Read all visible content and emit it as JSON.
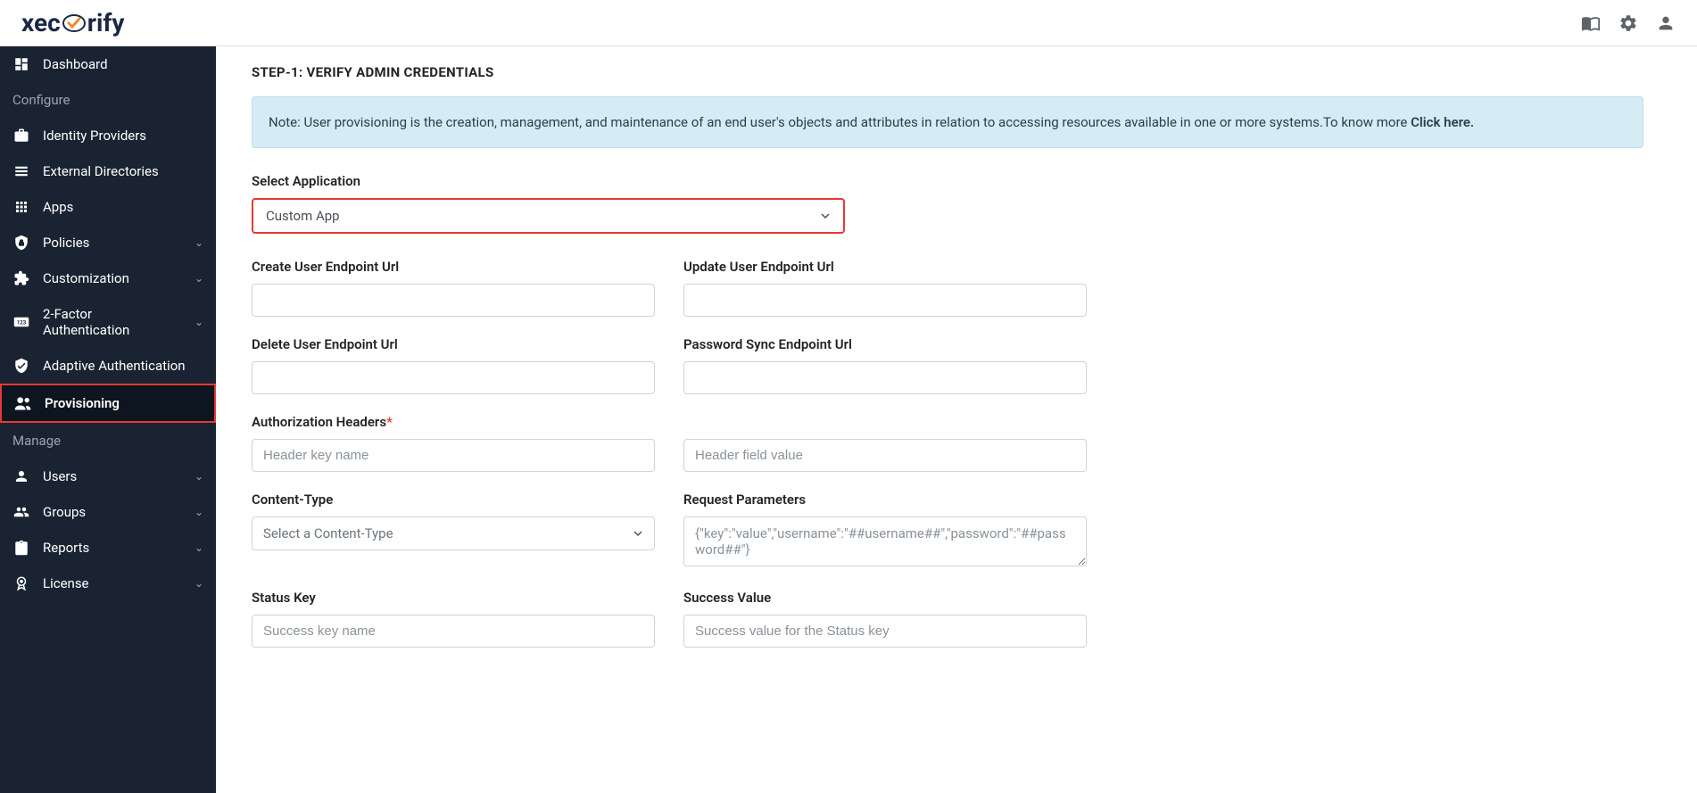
{
  "brand": {
    "pre": "xec",
    "post": "rify"
  },
  "sidebar": {
    "dashboard": "Dashboard",
    "configure_header": "Configure",
    "identity_providers": "Identity Providers",
    "external_directories": "External Directories",
    "apps": "Apps",
    "policies": "Policies",
    "customization": "Customization",
    "two_factor": "2-Factor Authentication",
    "adaptive_auth": "Adaptive Authentication",
    "provisioning": "Provisioning",
    "manage_header": "Manage",
    "users": "Users",
    "groups": "Groups",
    "reports": "Reports",
    "license": "License"
  },
  "main": {
    "step_title": "STEP-1: VERIFY ADMIN CREDENTIALS",
    "note_prefix": "Note: User provisioning is the creation, management, and maintenance of an end user's objects and attributes in relation to accessing resources available in one or more systems.To know more ",
    "note_link": "Click here.",
    "select_app_label": "Select Application",
    "select_app_value": "Custom App",
    "create_user_label": "Create User Endpoint Url",
    "update_user_label": "Update User Endpoint Url",
    "delete_user_label": "Delete User Endpoint Url",
    "password_sync_label": "Password Sync Endpoint Url",
    "auth_headers_label": "Authorization Headers",
    "header_key_ph": "Header key name",
    "header_val_ph": "Header field value",
    "content_type_label": "Content-Type",
    "content_type_value": "Select a Content-Type",
    "request_params_label": "Request Parameters",
    "request_params_ph": "{\"key\":\"value\",\"username\":\"##username##\",\"password\":\"##password##\"}",
    "status_key_label": "Status Key",
    "status_key_ph": "Success key name",
    "success_value_label": "Success Value",
    "success_value_ph": "Success value for the Status key"
  }
}
